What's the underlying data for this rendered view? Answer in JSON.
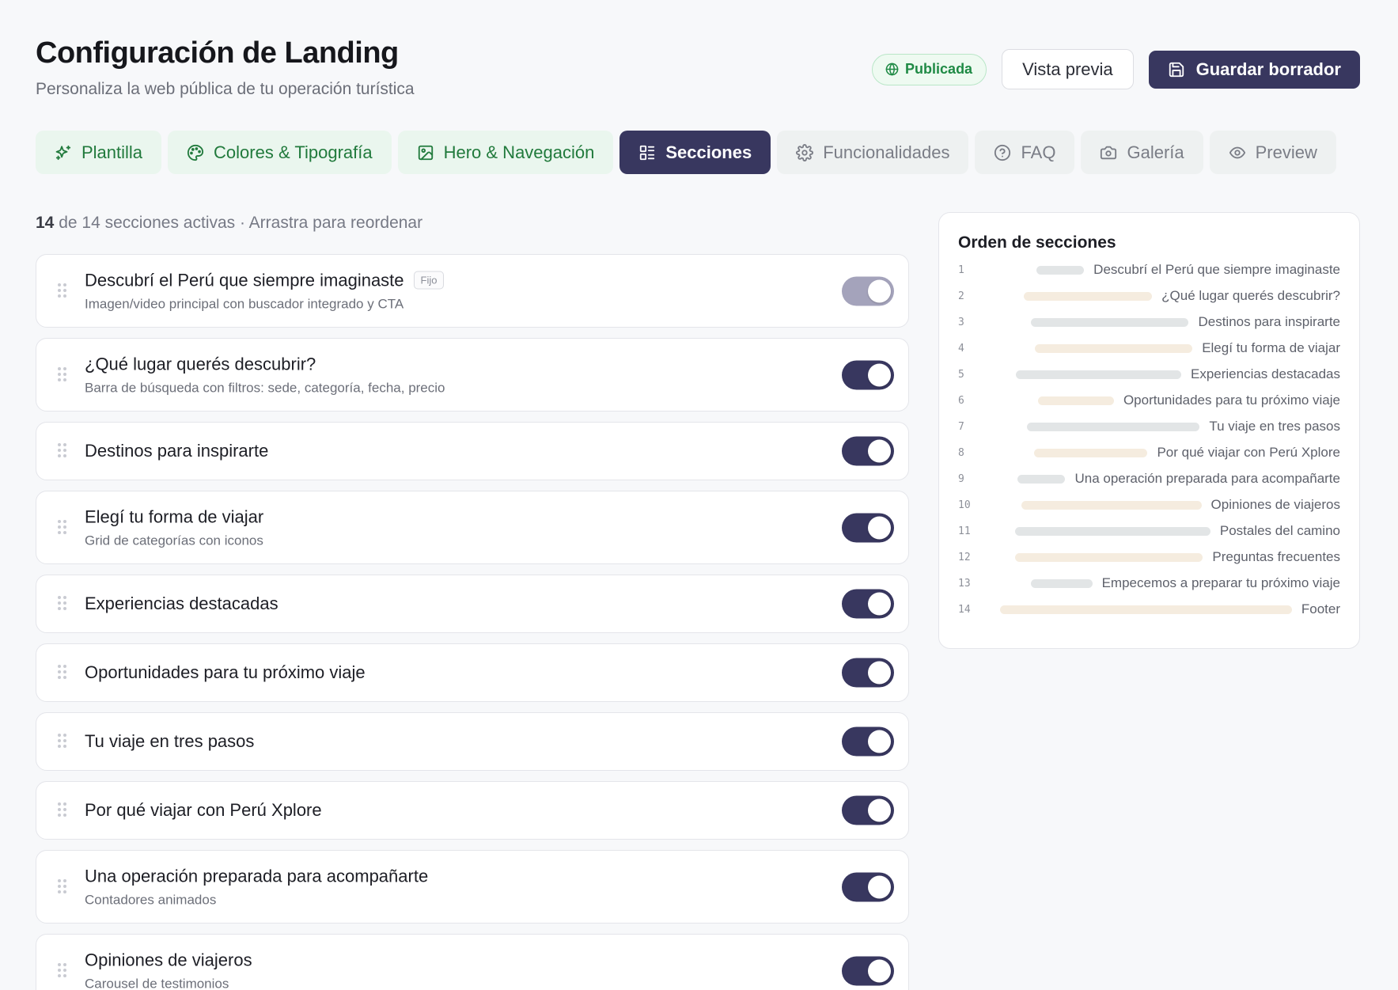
{
  "header": {
    "title": "Configuración de Landing",
    "subtitle": "Personaliza la web pública de tu operación turística",
    "status_badge": "Publicada",
    "preview_button": "Vista previa",
    "save_button": "Guardar borrador"
  },
  "tabs": [
    {
      "label": "Plantilla",
      "icon": "sparkles-icon",
      "state": "green"
    },
    {
      "label": "Colores & Tipografía",
      "icon": "palette-icon",
      "state": "green"
    },
    {
      "label": "Hero & Navegación",
      "icon": "image-icon",
      "state": "green"
    },
    {
      "label": "Secciones",
      "icon": "sections-icon",
      "state": "active"
    },
    {
      "label": "Funcionalidades",
      "icon": "gear-icon",
      "state": "default"
    },
    {
      "label": "FAQ",
      "icon": "help-circle-icon",
      "state": "default"
    },
    {
      "label": "Galería",
      "icon": "camera-icon",
      "state": "default"
    },
    {
      "label": "Preview",
      "icon": "eye-icon",
      "state": "default"
    }
  ],
  "summary": {
    "active": "14",
    "text": "de 14 secciones activas · Arrastra para reordenar"
  },
  "sections": [
    {
      "title": "Descubrí el Perú que siempre imaginaste",
      "tag": "Fijo",
      "desc": "Imagen/video principal con buscador integrado y CTA",
      "enabled": true,
      "locked": true
    },
    {
      "title": "¿Qué lugar querés descubrir?",
      "desc": "Barra de búsqueda con filtros: sede, categoría, fecha, precio",
      "enabled": true
    },
    {
      "title": "Destinos para inspirarte",
      "desc": "",
      "enabled": true
    },
    {
      "title": "Elegí tu forma de viajar",
      "desc": "Grid de categorías con iconos",
      "enabled": true
    },
    {
      "title": "Experiencias destacadas",
      "desc": "",
      "enabled": true
    },
    {
      "title": "Oportunidades para tu próximo viaje",
      "desc": "",
      "enabled": true
    },
    {
      "title": "Tu viaje en tres pasos",
      "desc": "",
      "enabled": true
    },
    {
      "title": "Por qué viajar con Perú Xplore",
      "desc": "",
      "enabled": true
    },
    {
      "title": "Una operación preparada para acompañarte",
      "desc": "Contadores animados",
      "enabled": true
    },
    {
      "title": "Opiniones de viajeros",
      "desc": "Carousel de testimonios",
      "enabled": true
    }
  ],
  "order_panel": {
    "title": "Orden de secciones",
    "items": [
      {
        "num": "1",
        "label": "Descubrí el Perú que siempre imaginaste"
      },
      {
        "num": "2",
        "label": "¿Qué lugar querés descubrir?"
      },
      {
        "num": "3",
        "label": "Destinos para inspirarte"
      },
      {
        "num": "4",
        "label": "Elegí tu forma de viajar"
      },
      {
        "num": "5",
        "label": "Experiencias destacadas"
      },
      {
        "num": "6",
        "label": "Oportunidades para tu próximo viaje"
      },
      {
        "num": "7",
        "label": "Tu viaje en tres pasos"
      },
      {
        "num": "8",
        "label": "Por qué viajar con Perú Xplore"
      },
      {
        "num": "9",
        "label": "Una operación preparada para acompañarte"
      },
      {
        "num": "10",
        "label": "Opiniones de viajeros"
      },
      {
        "num": "11",
        "label": "Postales del camino"
      },
      {
        "num": "12",
        "label": "Preguntas frecuentes"
      },
      {
        "num": "13",
        "label": "Empecemos a preparar tu próximo viaje"
      },
      {
        "num": "14",
        "label": "Footer"
      }
    ]
  },
  "colors": {
    "primary": "#38375f",
    "success": "#1f8a45",
    "bar_gray": "#e2e5e6",
    "bar_beige": "#f5ecdf"
  }
}
